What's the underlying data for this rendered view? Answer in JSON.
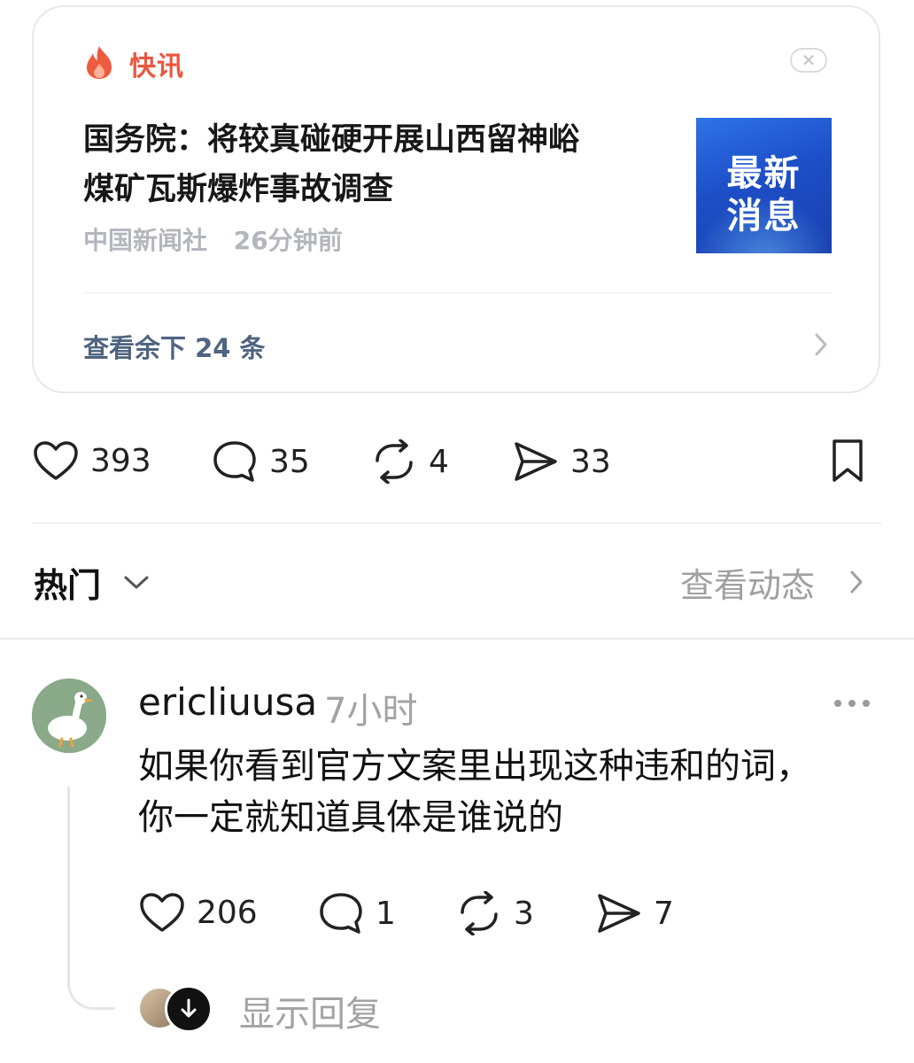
{
  "news_card": {
    "brand_label": "快讯",
    "brand_icon": "flame-icon",
    "headline_line1": "国务院：将较真碰硬开展山西留神峪",
    "headline_line2": "煤矿瓦斯爆炸事故调查",
    "source": "中国新闻社",
    "time_ago": "26分钟前",
    "thumbnail_line1": "最新",
    "thumbnail_line2": "消息",
    "more_link": "查看余下 24 条"
  },
  "post_actions": {
    "likes": "393",
    "comments": "35",
    "reposts": "4",
    "shares": "33"
  },
  "section": {
    "hot_label": "热门",
    "view_activity": "查看动态"
  },
  "comment": {
    "username": "ericliuusa",
    "time": "7小时",
    "text_line1": "如果你看到官方文案里出现这种违和的词，",
    "text_line2": "你一定就知道具体是谁说的",
    "likes": "206",
    "replies": "1",
    "reposts": "3",
    "shares": "7",
    "show_replies": "显示回复"
  },
  "colors": {
    "brand_red": "#e9573f",
    "link_blue_gray": "#4f6480",
    "muted_gray": "#a3a3a3",
    "thumbnail_blue": "#2f73e6"
  }
}
